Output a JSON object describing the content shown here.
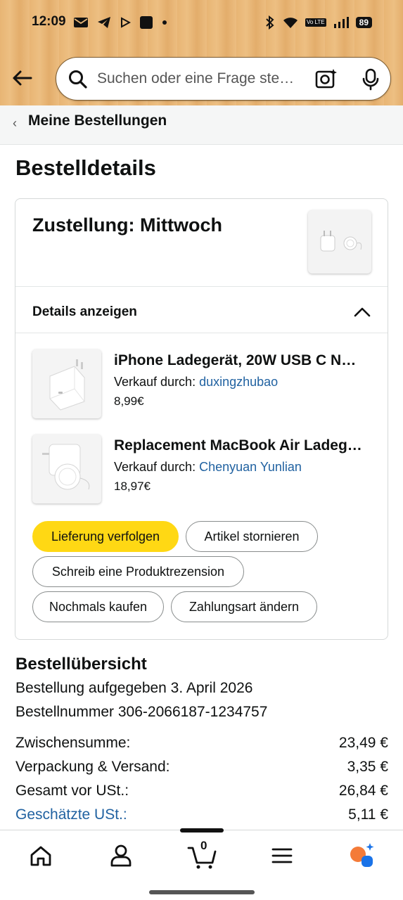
{
  "status_bar": {
    "time": "12:09",
    "battery": "89",
    "network": "Vo LTE",
    "left_icons": [
      "mail-icon",
      "telegram-icon",
      "play-icon",
      "app-square-icon",
      "dot-icon"
    ],
    "right_icons": [
      "bluetooth-icon",
      "wifi-icon",
      "lte-icon",
      "signal-icon",
      "battery-icon"
    ]
  },
  "search": {
    "placeholder": "Suchen oder eine Frage ste…"
  },
  "breadcrumb": {
    "label": "Meine Bestellungen"
  },
  "page": {
    "title": "Bestelldetails"
  },
  "delivery": {
    "title": "Zustellung: Mittwoch",
    "details_toggle": "Details anzeigen",
    "items": [
      {
        "title": "iPhone Ladegerät, 20W USB C N…",
        "seller_prefix": "Verkauf durch: ",
        "seller": "duxingzhubao",
        "price": "8,99€"
      },
      {
        "title": "Replacement MacBook Air Ladeg…",
        "seller_prefix": "Verkauf durch: ",
        "seller": "Chenyuan Yunlian",
        "price": "18,97€"
      }
    ],
    "actions": {
      "track": "Lieferung verfolgen",
      "cancel": "Artikel stornieren",
      "review": "Schreib eine Produktrezension",
      "buy_again": "Nochmals kaufen",
      "change_payment": "Zahlungsart ändern"
    }
  },
  "summary": {
    "title": "Bestellübersicht",
    "placed": "Bestellung aufgegeben 3. April 2026",
    "order_number": "Bestellnummer 306-2066187-1234757",
    "rows": [
      {
        "label": "Zwischensumme:",
        "value": "23,49 €"
      },
      {
        "label": "Verpackung & Versand:",
        "value": "3,35 €"
      },
      {
        "label": "Gesamt vor USt.:",
        "value": "26,84 €"
      },
      {
        "label": "Geschätzte USt.:",
        "value": "5,11 €"
      }
    ]
  },
  "bottom_nav": {
    "cart_count": "0",
    "items": [
      "home-icon",
      "account-icon",
      "cart-icon",
      "menu-icon",
      "rufus-icon"
    ]
  },
  "colors": {
    "primary_button": "#ffd814",
    "link": "#2162a1",
    "rufus_orange": "#f47b38",
    "rufus_blue": "#1a73e8"
  }
}
